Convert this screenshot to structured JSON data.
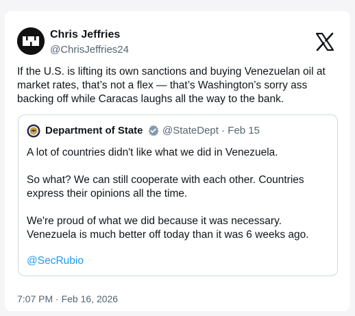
{
  "author": {
    "name": "Chris Jeffries",
    "handle": "@ChrisJeffries24"
  },
  "platform_icon": "x-logo-icon",
  "tweet": {
    "text": "If the U.S. is lifting its own sanctions and buying Venezuelan oil at market rates, that’s not a flex — that’s Washington’s sorry ass backing off while Caracas laughs all the way to the bank."
  },
  "quoted": {
    "name": "Department of State",
    "handle": "@StateDept",
    "separator": "·",
    "date": "Feb 15",
    "verified_icon": "verified-badge-icon",
    "avatar_icon": "state-department-seal-icon",
    "paragraphs": [
      "A lot of countries didn't like what we did in Venezuela.",
      "So what? We can still cooperate with each other. Countries express their opinions all the time.",
      "We're proud of what we did because it was necessary. Venezuela is much better off today than it was 6 weeks ago."
    ],
    "mention": "@SecRubio"
  },
  "timestamp": "7:07 PM · Feb 16, 2026",
  "colors": {
    "link": "#1d9bf0",
    "verified": "#829aab",
    "secondary_text": "#536471",
    "border": "#cfd9de"
  }
}
